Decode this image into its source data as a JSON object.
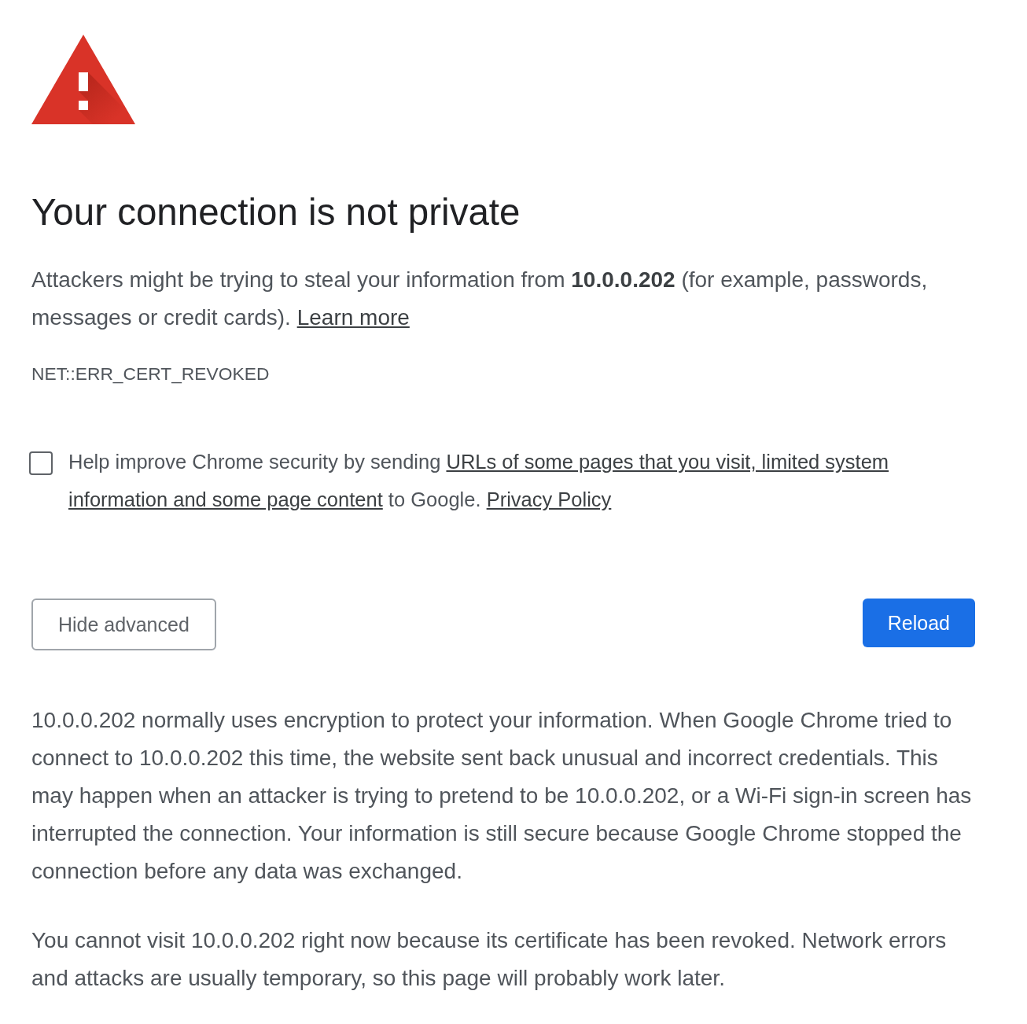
{
  "heading": "Your connection is not private",
  "intro": {
    "text": "Attackers might be trying to steal your information from **10.0.0.202** (for example, passwords, messages or credit cards).",
    "link": "Learn more"
  },
  "error_code": "NET::ERR_CERT_REVOKED",
  "reporting": {
    "checked": false,
    "parts": [
      {
        "kind": "text",
        "text": "Help improve Chrome security by sending"
      },
      {
        "kind": "link",
        "text": "URLs of some pages that you visit, limited system"
      },
      {
        "kind": "link",
        "text": "information and some page content"
      },
      {
        "kind": "text",
        "text": "to Google."
      },
      {
        "kind": "link",
        "text": "Privacy Policy"
      }
    ]
  },
  "buttons": [
    {
      "kind": "outlined",
      "label": "Hide advanced"
    },
    {
      "kind": "filled",
      "label": "Reload"
    }
  ],
  "details": [
    "10.0.0.202 normally uses encryption to protect your information. When Google Chrome tried to connect to 10.0.0.202 this time, the website sent back unusual and incorrect credentials. This may happen when an attacker is trying to pretend to be 10.0.0.202, or a Wi-Fi sign-in screen has interrupted the connection. Your information is still secure because Google Chrome stopped the connection before any data was exchanged.",
    "You cannot visit 10.0.0.202 right now because its certificate has been revoked. Network errors and attacks are usually temporary, so this page will probably work later."
  ]
}
